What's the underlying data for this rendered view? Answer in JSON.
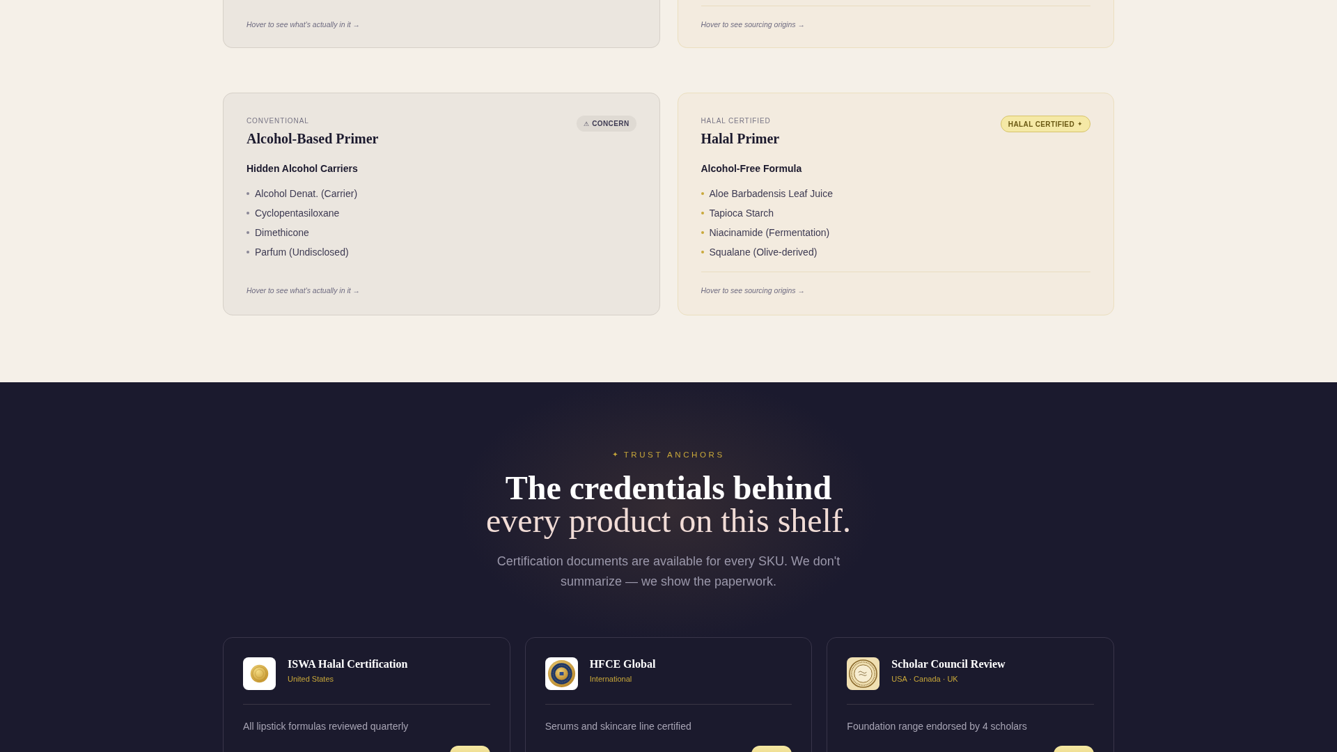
{
  "comparison_rows": [
    {
      "cards": [
        {
          "kind": "conventional",
          "footer": "Hover to see what's actually in it →"
        },
        {
          "kind": "halal",
          "footer": "Hover to see sourcing origins →"
        }
      ]
    },
    {
      "cards": [
        {
          "kind": "conventional",
          "category": "CONVENTIONAL",
          "title": "Alcohol-Based Primer",
          "badge": {
            "leading_icon": "⚠",
            "text": "CONCERN"
          },
          "list_heading": "Hidden Alcohol Carriers",
          "ingredients": [
            "Alcohol Denat. (Carrier)",
            "Cyclopentasiloxane",
            "Dimethicone",
            "Parfum (Undisclosed)"
          ],
          "footer": "Hover to see what's actually in it →"
        },
        {
          "kind": "halal",
          "category": "HALAL CERTIFIED",
          "title": "Halal Primer",
          "badge": {
            "text": "HALAL CERTIFIED",
            "trailing_icon": "✦"
          },
          "list_heading": "Alcohol-Free Formula",
          "ingredients": [
            "Aloe Barbadensis Leaf Juice",
            "Tapioca Starch",
            "Niacinamide (Fermentation)",
            "Squalane (Olive-derived)"
          ],
          "footer": "Hover to see sourcing origins →"
        }
      ]
    }
  ],
  "trust_section": {
    "eyebrow_icon": "✦",
    "eyebrow": "TRUST ANCHORS",
    "heading_line_1": "The credentials behind",
    "heading_line_2": "every product on this shelf.",
    "description": "Certification documents are available for every SKU. We don't summarize — we show the paperwork.",
    "certifiers": [
      {
        "name": "ISWA Halal Certification",
        "region": "United States",
        "note": "All lipstick formulas reviewed quarterly"
      },
      {
        "name": "HFCE Global",
        "region": "International",
        "note": "Serums and skincare line certified"
      },
      {
        "name": "Scholar Council Review",
        "region": "USA · Canada · UK",
        "note": "Foundation range endorsed by 4 scholars"
      }
    ]
  }
}
